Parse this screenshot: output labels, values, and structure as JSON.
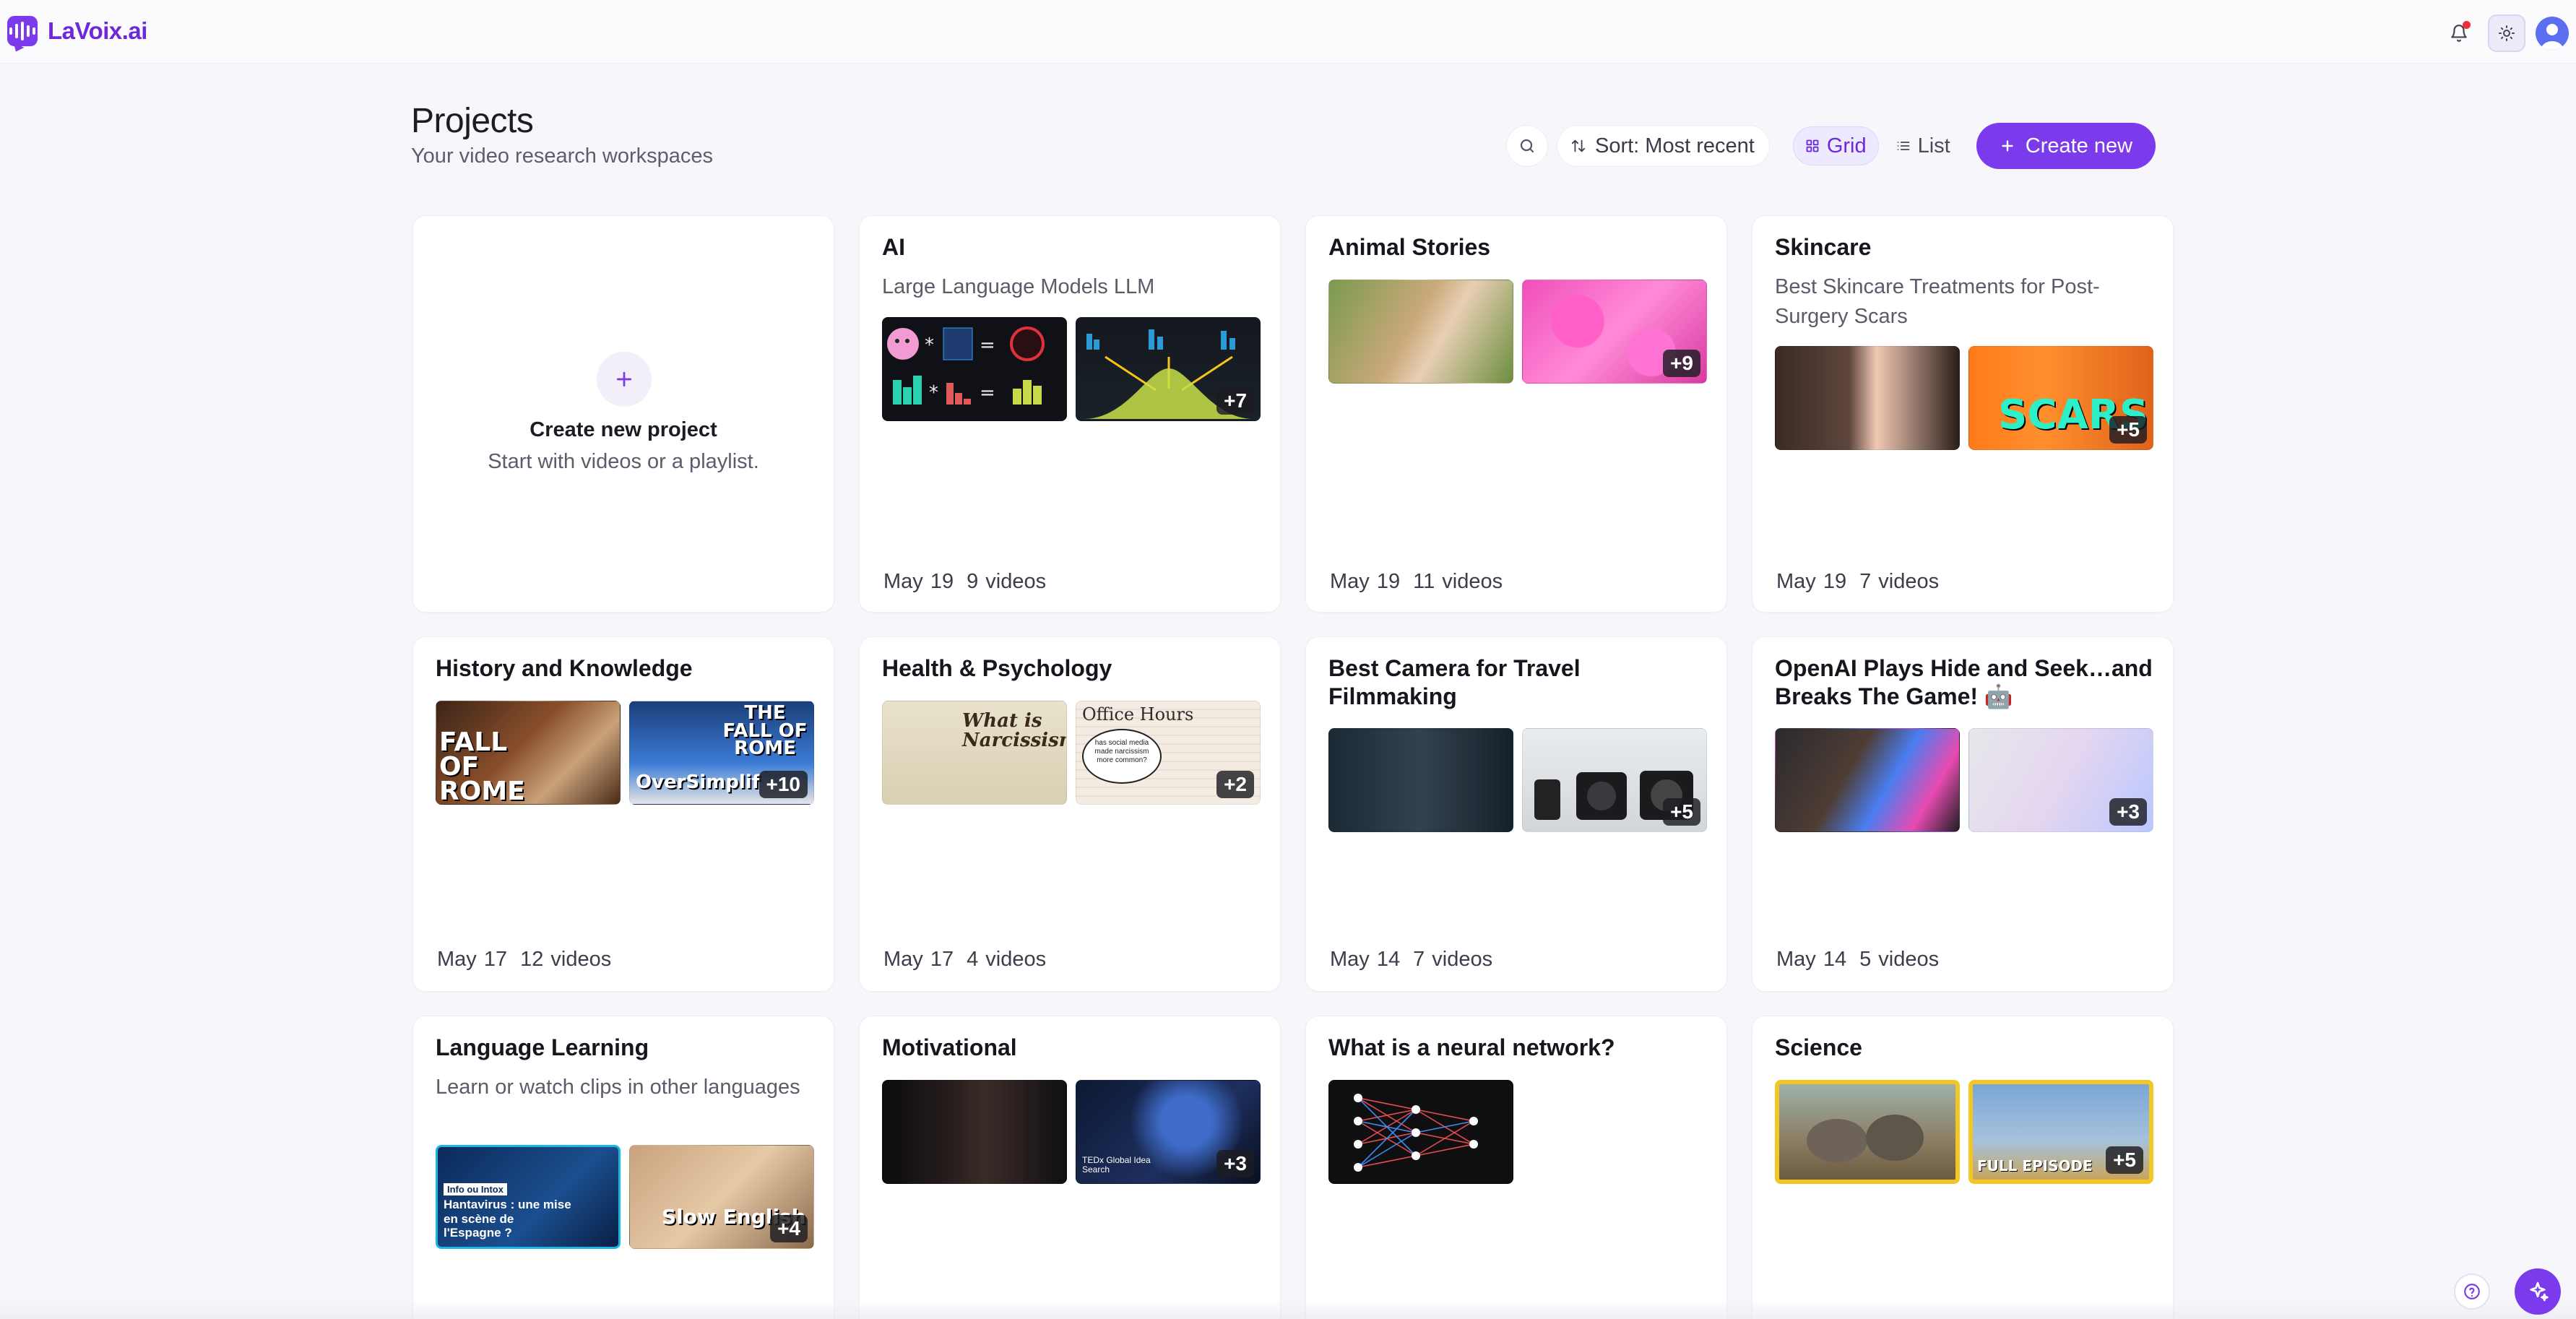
{
  "app": {
    "name": "LaVoix.ai",
    "accent": "#7c3aed"
  },
  "header": {
    "title": "Projects",
    "subtitle": "Your video research workspaces"
  },
  "toolbar": {
    "search_icon": "search-icon",
    "sort_label": "Sort: Most recent",
    "view_grid_label": "Grid",
    "view_list_label": "List",
    "active_view": "Grid",
    "create_label": "Create new"
  },
  "create_card": {
    "title": "Create new project",
    "subtitle": "Start with videos or a playlist."
  },
  "projects": [
    {
      "title": "AI",
      "description": "Large Language Models LLM",
      "date": "May 19",
      "videos": "9 videos",
      "more": "+7"
    },
    {
      "title": "Animal Stories",
      "description": "",
      "date": "May 19",
      "videos": "11 videos",
      "more": "+9"
    },
    {
      "title": "Skincare",
      "description": "Best Skincare Treatments for Post-Surgery Scars",
      "date": "May 19",
      "videos": "7 videos",
      "more": "+5"
    },
    {
      "title": "History and Knowledge",
      "description": "",
      "date": "May 17",
      "videos": "12 videos",
      "more": "+10"
    },
    {
      "title": "Health & Psychology",
      "description": "",
      "date": "May 17",
      "videos": "4 videos",
      "more": "+2"
    },
    {
      "title": "Best Camera for Travel Filmmaking",
      "description": "",
      "date": "May 14",
      "videos": "7 videos",
      "more": "+5"
    },
    {
      "title": "OpenAI Plays Hide and Seek…and Breaks The Game! 🤖",
      "description": "",
      "date": "May 14",
      "videos": "5 videos",
      "more": "+3"
    },
    {
      "title": "Language Learning",
      "description": "Learn or watch clips in other languages",
      "date": "",
      "videos": "",
      "more": "+4"
    },
    {
      "title": "Motivational",
      "description": "",
      "date": "",
      "videos": "",
      "more": "+3"
    },
    {
      "title": "What is a neural network?",
      "description": "",
      "date": "",
      "videos": "",
      "more": ""
    },
    {
      "title": "Science",
      "description": "",
      "date": "",
      "videos": "",
      "more": "+5"
    }
  ],
  "thumbnail_text": {
    "hist1": "FALL OF ROME",
    "hist2_top": "THE FALL OF ROME",
    "hist2_bottom": "OverSimplif",
    "psy1": "What is Narcissism?",
    "psy2_title": "Office Hours",
    "psy2_bubble": "has social media made narcissism more common?",
    "skin2": "SCARS",
    "lang1_tag": "Info ou Intox",
    "lang1": "Hantavirus : une mise en scène de l'Espagne ?",
    "lang2": "Slow English",
    "mot2": "TEDx Global Idea Search",
    "sci2": "FULL EPISODE"
  }
}
